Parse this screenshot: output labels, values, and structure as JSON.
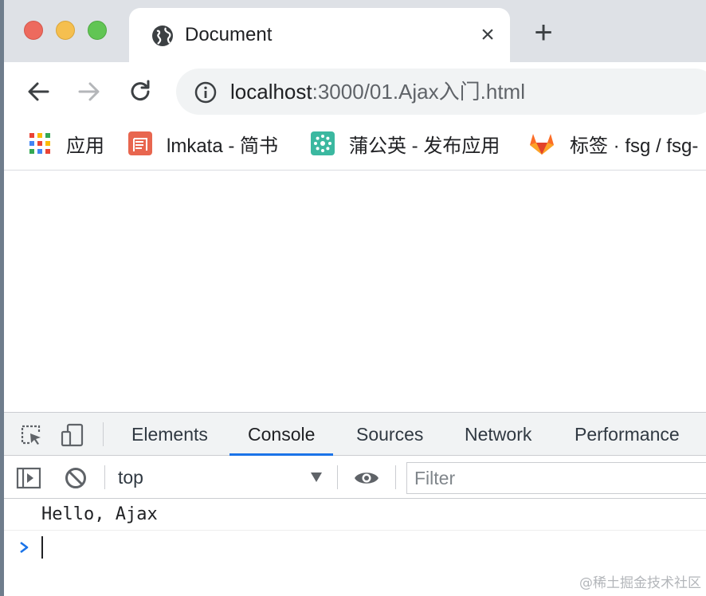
{
  "tab": {
    "title": "Document",
    "close_label": "×"
  },
  "new_tab_label": "+",
  "omnibox": {
    "host": "localhost",
    "rest": ":3000/01.Ajax入门.html"
  },
  "bookmarks": [
    {
      "label": "应用",
      "icon": "apps-grid-icon"
    },
    {
      "label": "lmkata - 简书",
      "icon": "jianshu-icon"
    },
    {
      "label": "蒲公英 - 发布应用",
      "icon": "pgyer-icon"
    },
    {
      "label": "标签 · fsg / fsg-",
      "icon": "gitlab-icon"
    }
  ],
  "devtools": {
    "tabs": [
      {
        "label": "Elements"
      },
      {
        "label": "Console"
      },
      {
        "label": "Sources"
      },
      {
        "label": "Network"
      },
      {
        "label": "Performance"
      }
    ],
    "active_tab": "Console",
    "context": "top",
    "filter_placeholder": "Filter",
    "console_output": "Hello, Ajax"
  },
  "watermark": "@稀土掘金技术社区",
  "colors": {
    "accent": "#1a73e8",
    "tabstrip": "#dee1e6",
    "omnibox": "#f1f3f4"
  }
}
